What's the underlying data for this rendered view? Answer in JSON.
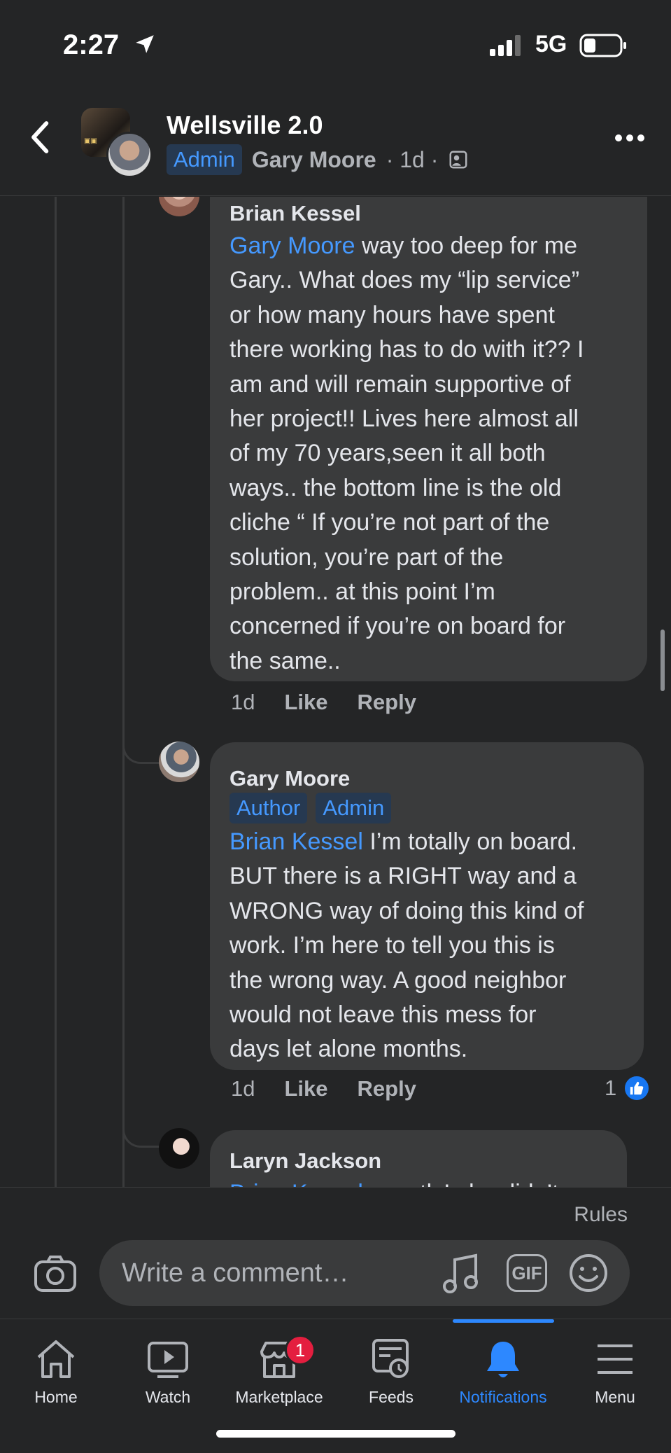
{
  "status_bar": {
    "time": "2:27",
    "network": "5G"
  },
  "header": {
    "group_name": "Wellsville 2.0",
    "badge": "Admin",
    "poster": "Gary Moore",
    "time": "· 1d ·"
  },
  "comments": [
    {
      "author": "Brian Kessel",
      "mention": "Gary Moore",
      "lines": [
        " way too deep for me",
        "Gary.. What does my “lip service”",
        "or how many hours have spent",
        "there working has to do with it?? I",
        "am and will remain supportive of",
        "her project!! Lives here almost all",
        "of my 70 years,seen it all both",
        "ways.. the bottom line is the old",
        "cliche “ If you’re not part of the",
        "solution, you’re part of the",
        "problem.. at this point I’m",
        "concerned if you’re on board for",
        "the same.."
      ],
      "time": "1d",
      "like": "Like",
      "reply": "Reply"
    },
    {
      "author": "Gary Moore",
      "badges": [
        "Author",
        "Admin"
      ],
      "mention": "Brian Kessel",
      "lines": [
        " I’m totally on board.",
        "BUT there is a RIGHT way and a",
        "WRONG way of doing this kind of",
        "work. I’m here to tell you this is",
        "the wrong way. A good neighbor",
        "would not leave this mess for",
        "days let alone months."
      ],
      "time": "1d",
      "like": "Like",
      "reply": "Reply",
      "reaction_count": "1"
    },
    {
      "author": "Laryn Jackson",
      "mention": "Brian Kessel",
      "partial": " exactly! she didn’t"
    }
  ],
  "composer": {
    "rules": "Rules",
    "placeholder": "Write a comment…",
    "gif": "GIF"
  },
  "tabs": [
    {
      "label": "Home",
      "icon": "home-icon"
    },
    {
      "label": "Watch",
      "icon": "watch-icon"
    },
    {
      "label": "Marketplace",
      "icon": "marketplace-icon",
      "badge": "1"
    },
    {
      "label": "Feeds",
      "icon": "feeds-icon"
    },
    {
      "label": "Notifications",
      "icon": "bell-icon",
      "active": true
    },
    {
      "label": "Menu",
      "icon": "menu-icon"
    }
  ],
  "colors": {
    "accent": "#2d88ff",
    "bubble": "#3a3b3c",
    "background": "#242526",
    "mention": "#4599ff"
  }
}
